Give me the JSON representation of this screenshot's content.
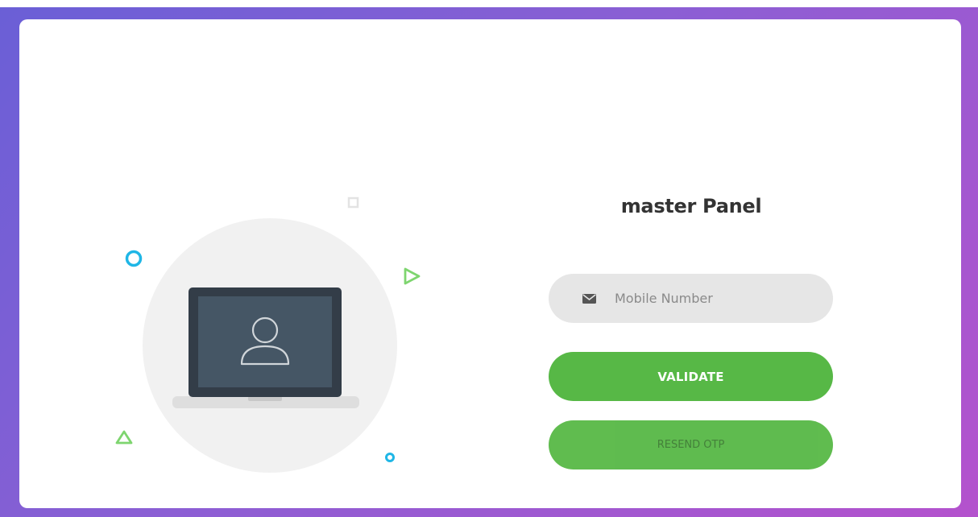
{
  "page": {
    "title": "master Panel"
  },
  "form": {
    "mobile_placeholder": "Mobile Number",
    "mobile_value": "",
    "validate_label": "VALIDATE",
    "resend_label": "RESEND OTP"
  },
  "icons": {
    "input_icon": "envelope-icon",
    "illustration_icon": "user-icon"
  },
  "colors": {
    "accent_green": "#57b846",
    "background_gradient_start": "#6a5fd6",
    "background_gradient_end": "#b452cd",
    "input_background": "#e6e6e6",
    "title_text": "#333333",
    "decor_blue": "#1fb6e6",
    "decor_green": "#7ed56f"
  }
}
